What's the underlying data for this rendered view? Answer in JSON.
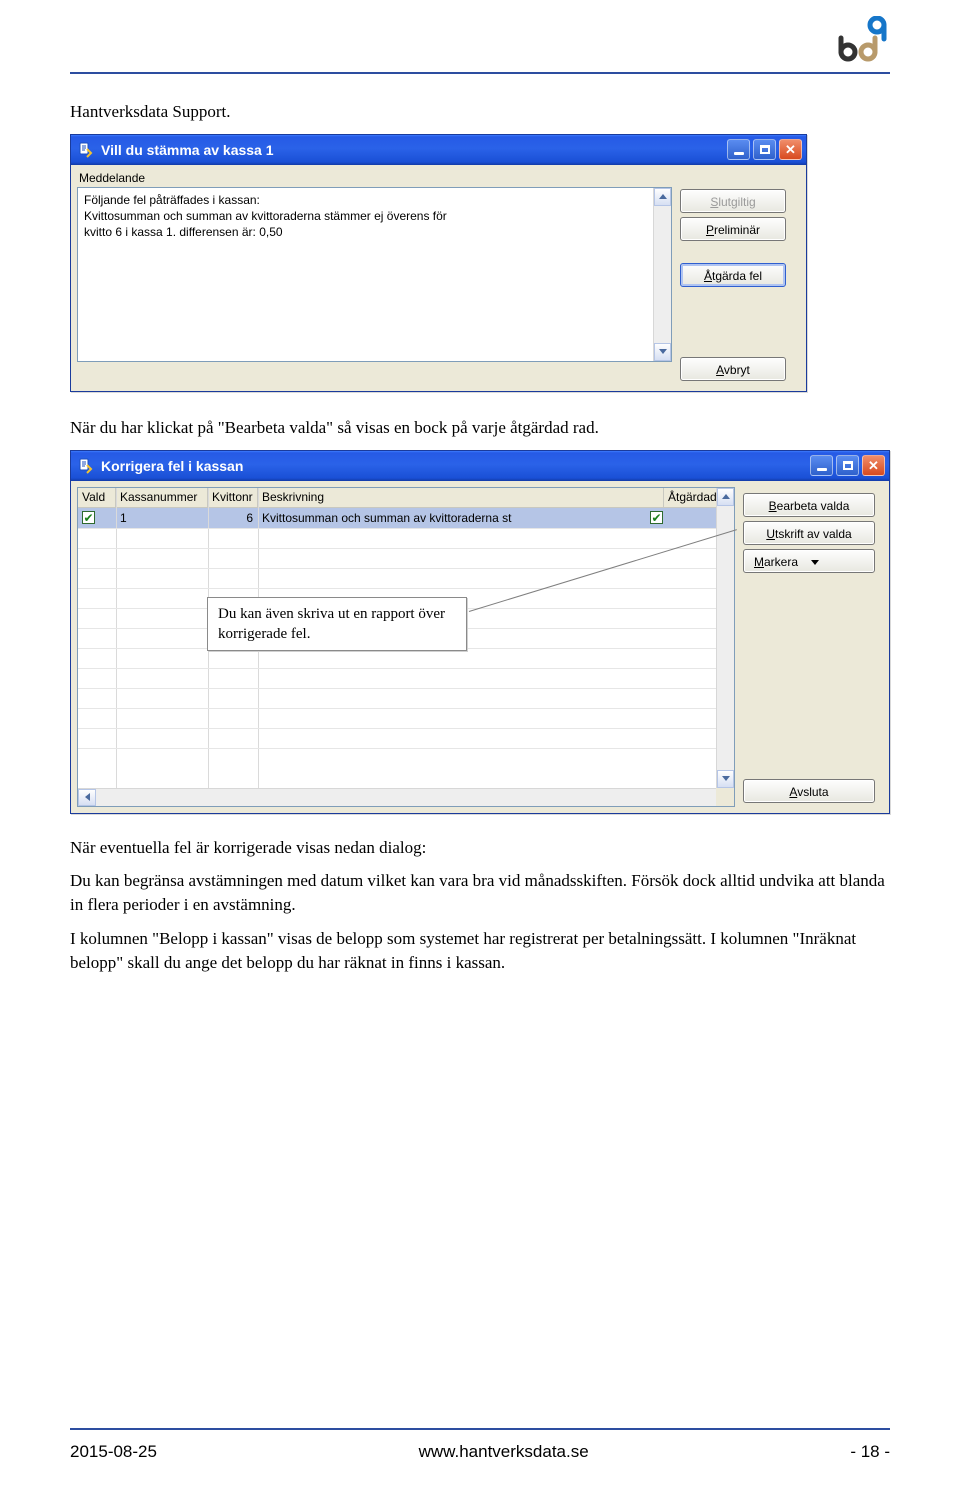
{
  "heading": "Hantverksdata Support.",
  "para1": "När du har klickat på \"Bearbeta valda\" så visas en bock på varje åtgärdad rad.",
  "callout_text": "Du kan även skriva ut en rapport över korrigerade fel.",
  "para2_lead": "När eventuella fel är korrigerade visas nedan dialog:",
  "para3": "Du kan begränsa avstämningen med datum vilket kan vara bra vid månadsskiften. Försök dock alltid undvika att blanda in flera perioder i en avstämning.",
  "para4": "I kolumnen \"Belopp i kassan\" visas de belopp som systemet har registrerat per betalningssätt. I kolumnen \"Inräknat belopp\" skall du ange det belopp du har räknat in finns i kassan.",
  "dialog1": {
    "title": "Vill du stämma av kassa 1",
    "group_label": "Meddelande",
    "message_l1": "Följande fel påträffades i kassan:",
    "message_l2": "Kvittosumman och summan av kvittoraderna stämmer ej överens för",
    "message_l3": "kvitto 6 i kassa 1. differensen är: 0,50",
    "btn_slutgiltig": "Slutgiltig",
    "btn_preliminar": "Preliminär",
    "btn_atgarda": "Åtgärda fel",
    "btn_avbryt": "Avbryt"
  },
  "dialog2": {
    "title": "Korrigera fel i kassan",
    "columns": {
      "vald": "Vald",
      "kassanummer": "Kassanummer",
      "kvittonr": "Kvittonr",
      "beskrivning": "Beskrivning",
      "atgardad": "Åtgärdad"
    },
    "row": {
      "kassanummer": "1",
      "kvittonr": "6",
      "beskrivning": "Kvittosumman och summan av kvittoraderna st"
    },
    "btn_bearbeta": "Bearbeta valda",
    "btn_utskrift": "Utskrift av valda",
    "btn_markera": "Markera",
    "btn_avsluta": "Avsluta"
  },
  "footer": {
    "left": "2015-08-25",
    "center": "www.hantverksdata.se",
    "right": "- 18 -"
  }
}
